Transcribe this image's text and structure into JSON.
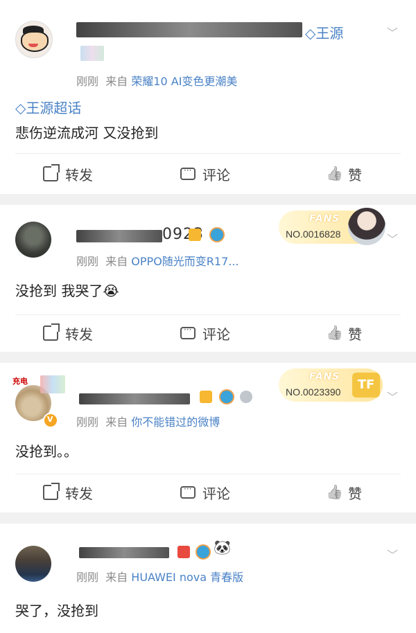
{
  "actions": {
    "repost": "转发",
    "comment": "评论",
    "like": "赞"
  },
  "time": "刚刚",
  "from_prefix": "来自",
  "posts": [
    {
      "name_visible": "王源",
      "source": "荣耀10 AI变色更潮美",
      "topic": "王源超话",
      "content": "悲伤逆流成河  又没抢到"
    },
    {
      "name_visible": "0923",
      "source": "OPPO随光而变R17...",
      "content": "没抢到 我哭了😭",
      "fans": {
        "title": "FANS",
        "number": "NO.0016828"
      }
    },
    {
      "avatar_text": "充电",
      "source": "你不能错过的微博",
      "content": "没抢到。。",
      "fans": {
        "title": "FANS",
        "number": "NO.0023390",
        "logo": "TF"
      }
    },
    {
      "source": "HUAWEI nova 青春版",
      "content": "哭了，没抢到"
    }
  ],
  "icons": {
    "more": "chevron-down-icon",
    "repost": "share-icon",
    "comment": "comment-icon",
    "like": "thumbs-up-icon",
    "super_topic": "diamond-icon"
  },
  "colors": {
    "link": "#4a82c6",
    "meta": "#8a8a8a",
    "fans_bg": "#ffe6a0",
    "accent": "#ff8a00"
  }
}
